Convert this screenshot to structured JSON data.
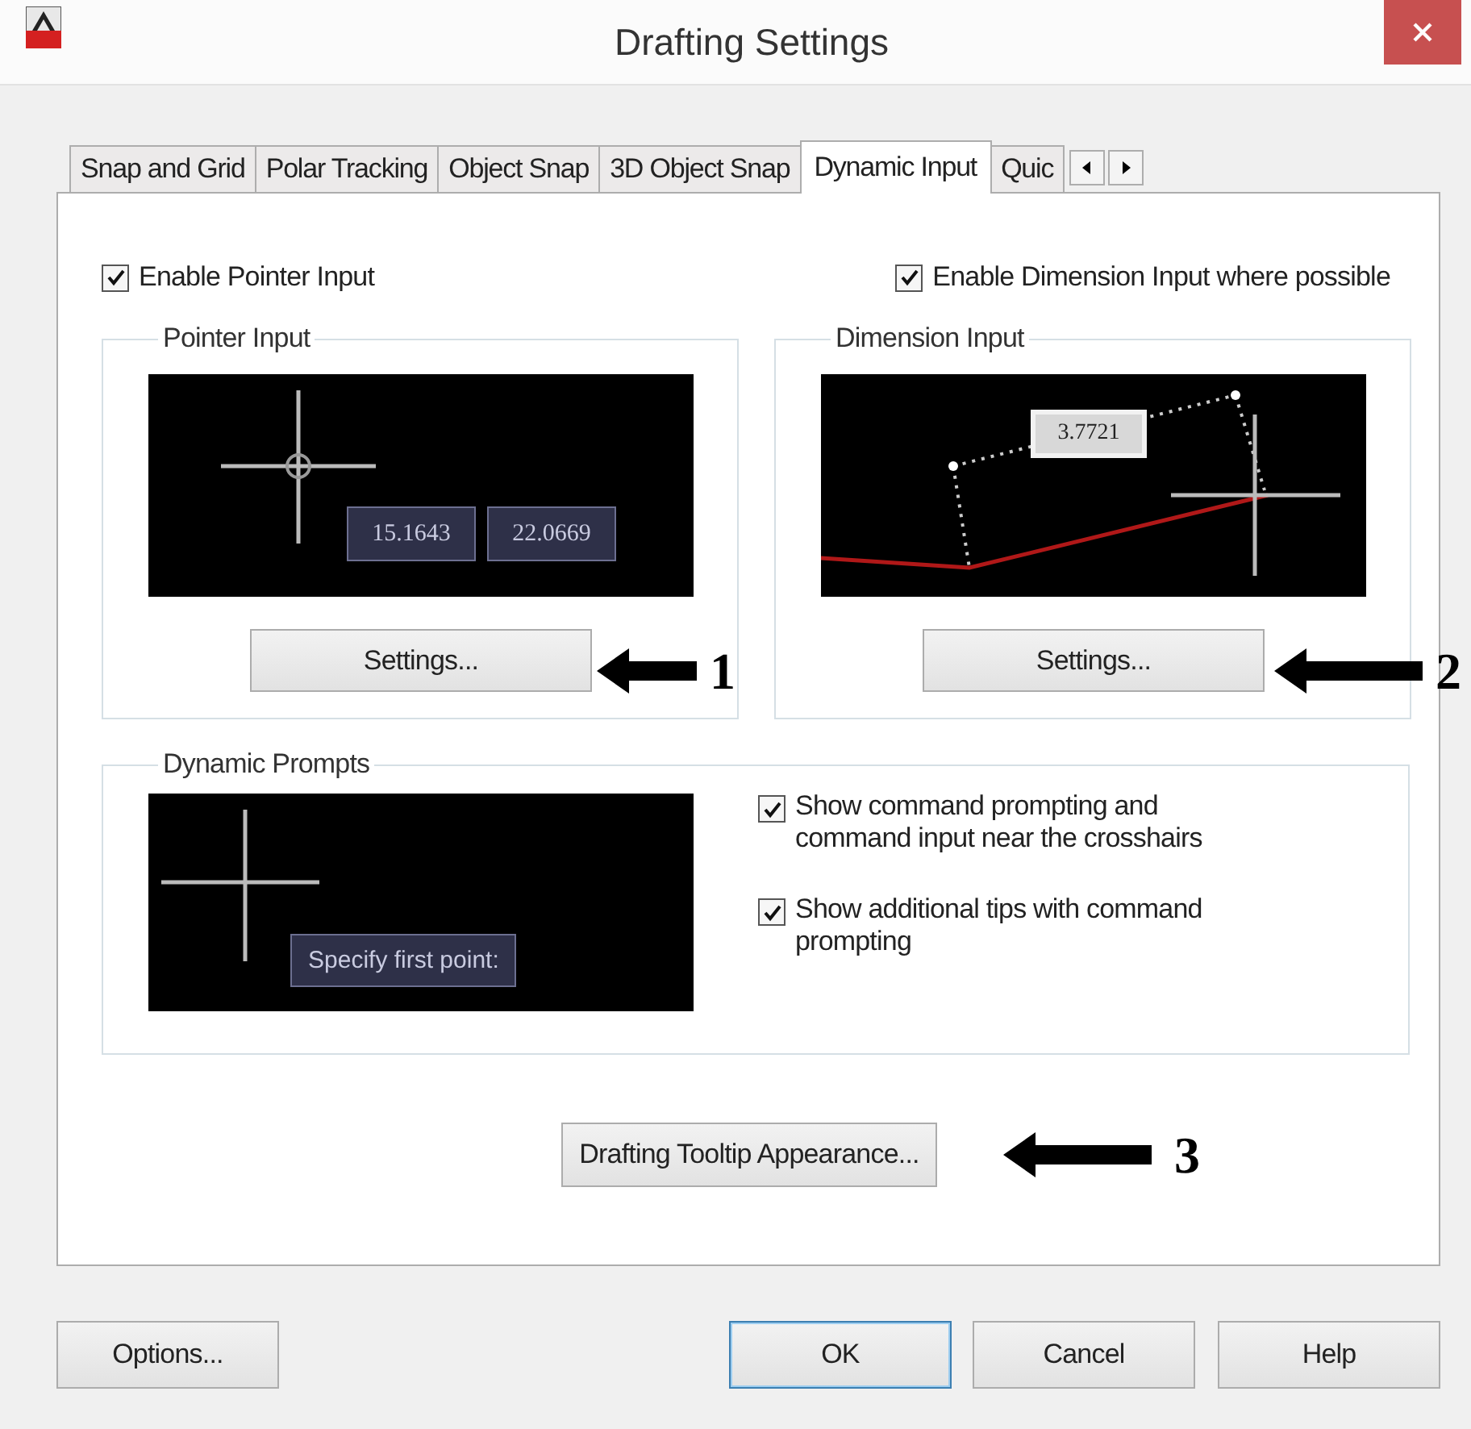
{
  "window": {
    "title": "Drafting Settings"
  },
  "tabs": [
    {
      "label": "Snap and Grid",
      "selected": false
    },
    {
      "label": "Polar Tracking",
      "selected": false
    },
    {
      "label": "Object Snap",
      "selected": false
    },
    {
      "label": "3D Object Snap",
      "selected": false
    },
    {
      "label": "Dynamic Input",
      "selected": true
    },
    {
      "label": "Quic",
      "selected": false
    }
  ],
  "top_options": [
    {
      "label": "Enable Pointer Input",
      "checked": true
    },
    {
      "label": "Enable Dimension Input where possible",
      "checked": true
    }
  ],
  "pointer_input": {
    "title": "Pointer Input",
    "preview_values": [
      "15.1643",
      "22.0669"
    ],
    "button": "Settings..."
  },
  "dimension_input": {
    "title": "Dimension Input",
    "preview_value": "3.7721",
    "button": "Settings..."
  },
  "dynamic_prompts": {
    "title": "Dynamic Prompts",
    "preview_prompt": "Specify first point:",
    "options": [
      {
        "label": "Show command prompting and command input near the crosshairs",
        "checked": true
      },
      {
        "label": "Show additional tips with command prompting",
        "checked": true
      }
    ]
  },
  "tooltip_button": "Drafting Tooltip Appearance...",
  "annotations": [
    {
      "label": "1"
    },
    {
      "label": "2"
    },
    {
      "label": "3"
    }
  ],
  "buttons": [
    {
      "label": "Options...",
      "default": false
    },
    {
      "label": "OK",
      "default": true
    },
    {
      "label": "Cancel",
      "default": false
    },
    {
      "label": "Help",
      "default": false
    }
  ]
}
